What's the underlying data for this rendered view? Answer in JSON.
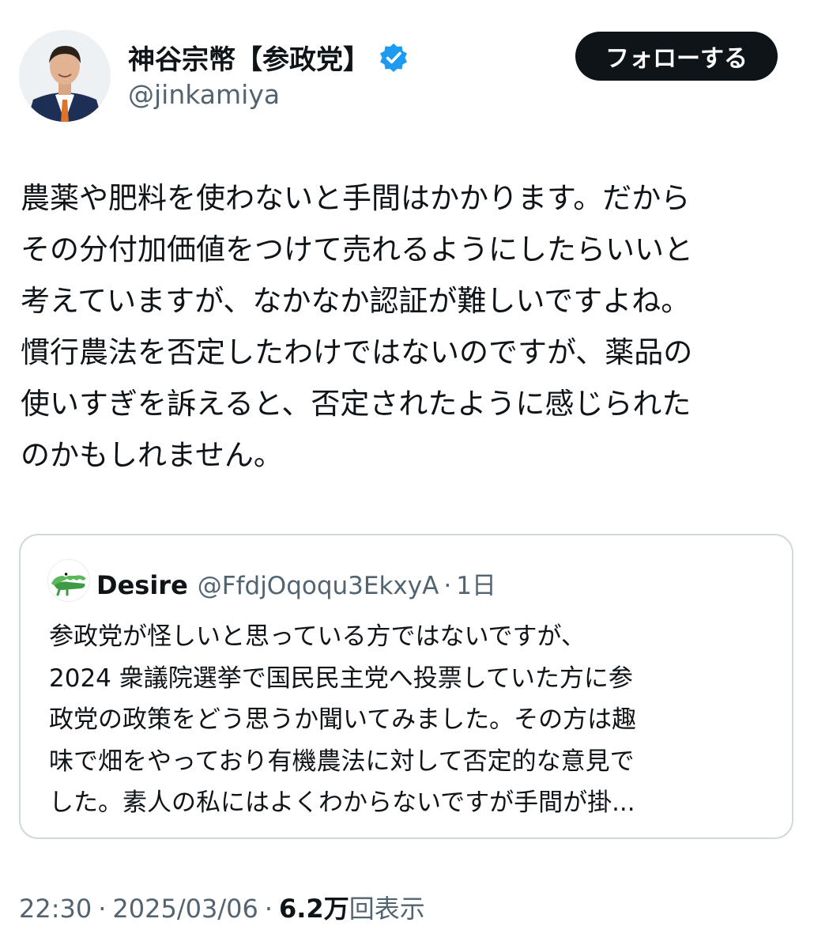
{
  "author": {
    "display_name": "神谷宗幣【参政党】",
    "handle": "@jinkamiya",
    "verified": true
  },
  "follow_button": {
    "label": "フォローする"
  },
  "tweet": {
    "lines": [
      "農薬や肥料を使わないと手間はかかります。だから",
      "その分付加価値をつけて売れるようにしたらいいと",
      "考えていますが、なかなか認証が難しいですよね。",
      "慣行農法を否定したわけではないのですが、薬品の",
      "使いすぎを訴えると、否定されたように感じられた",
      "のかもしれません。"
    ]
  },
  "quote": {
    "display_name": "Desire",
    "handle": "@FfdjOqoqu3EkxyA",
    "separator": "·",
    "time": "1日",
    "lines": [
      "参政党が怪しいと思っている方ではないですが、",
      "2024 衆議院選挙で国民民主党へ投票していた方に参",
      "政党の政策をどう思うか聞いてみました。その方は趣",
      "味で畑をやっており有機農法に対して否定的な意見で",
      "した。素人の私にはよくわからないですが手間が掛..."
    ]
  },
  "meta": {
    "time": "22:30",
    "separator": "·",
    "date": "2025/03/06",
    "views_count": "6.2万",
    "views_label": "回表示"
  },
  "colors": {
    "text_primary": "#0f1419",
    "text_secondary": "#536471",
    "verified_badge": "#1d9bf0",
    "follow_bg": "#0f1419",
    "border": "#cfd9de"
  },
  "icons": {
    "verified": "verified-badge-icon",
    "quote_avatar": "crocodile-avatar"
  }
}
